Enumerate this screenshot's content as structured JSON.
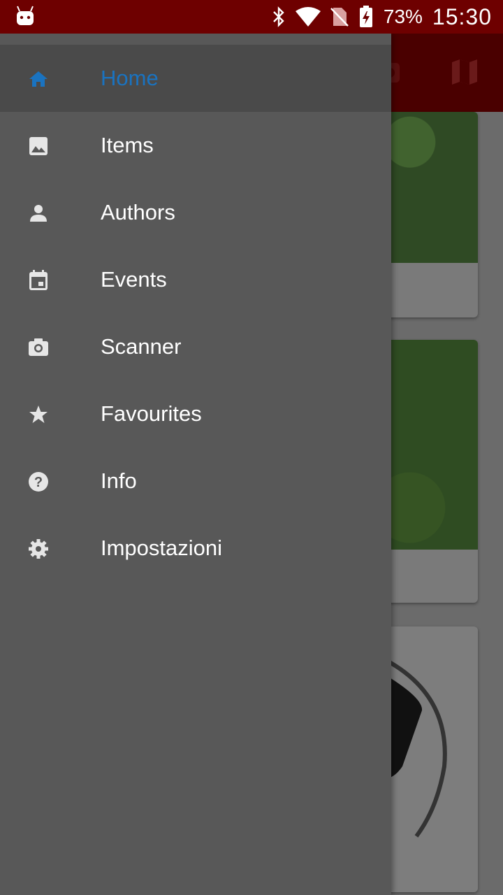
{
  "status_bar": {
    "battery_percent": "73%",
    "time": "15:30",
    "icons": [
      "android-debug-icon",
      "bluetooth-icon",
      "wifi-icon",
      "no-sim-icon",
      "battery-charging-icon"
    ]
  },
  "drawer": {
    "items": [
      {
        "label": "Home",
        "icon": "home-icon",
        "active": true
      },
      {
        "label": "Items",
        "icon": "image-icon",
        "active": false
      },
      {
        "label": "Authors",
        "icon": "person-icon",
        "active": false
      },
      {
        "label": "Events",
        "icon": "calendar-icon",
        "active": false
      },
      {
        "label": "Scanner",
        "icon": "camera-icon",
        "active": false
      },
      {
        "label": "Favourites",
        "icon": "star-icon",
        "active": false
      },
      {
        "label": "Info",
        "icon": "help-icon",
        "active": false
      },
      {
        "label": "Impostazioni",
        "icon": "settings-icon",
        "active": false
      }
    ]
  },
  "colors": {
    "status_bar": "#6e0000",
    "drawer_bg": "#585858",
    "active_item_bg": "#4a4a4a",
    "active_label": "#1a73c0"
  }
}
